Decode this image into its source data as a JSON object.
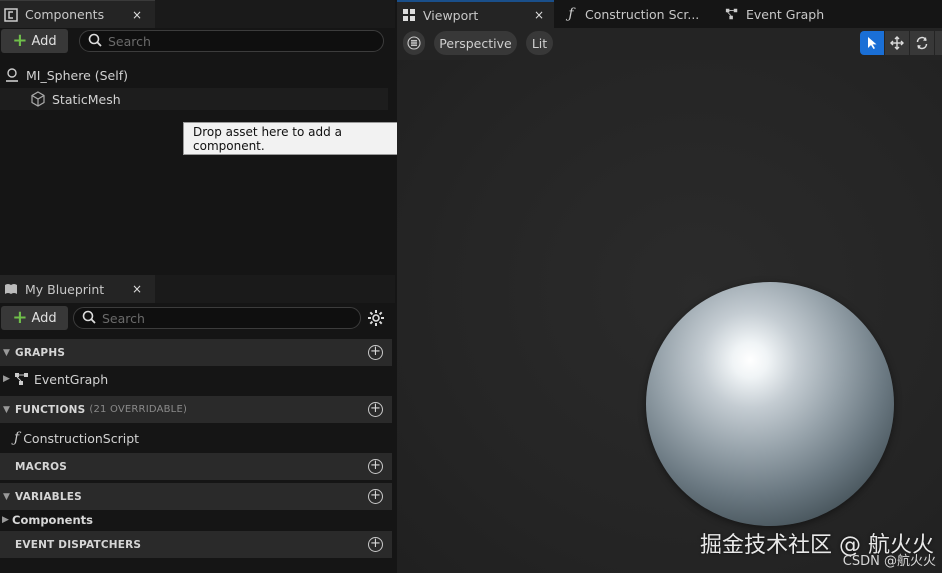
{
  "components_panel": {
    "tab_label": "Components",
    "close_glyph": "×",
    "add_label": "Add",
    "search_placeholder": "Search",
    "root_item": "MI_Sphere (Self)",
    "child_item": "StaticMesh",
    "tooltip": "Drop asset here to add a component."
  },
  "my_blueprint": {
    "tab_label": "My Blueprint",
    "close_glyph": "×",
    "add_label": "Add",
    "search_placeholder": "Search",
    "sections": {
      "graphs": "GRAPHS",
      "functions": "FUNCTIONS",
      "functions_note": "(21 OVERRIDABLE)",
      "macros": "MACROS",
      "variables": "VARIABLES",
      "components": "Components",
      "event_dispatchers": "EVENT DISPATCHERS"
    },
    "items": {
      "event_graph": "EventGraph",
      "construction_script": "ConstructionScript"
    }
  },
  "editor_tabs": {
    "viewport": "Viewport",
    "construction_script": "Construction Scr...",
    "event_graph": "Event Graph",
    "close_glyph": "×"
  },
  "viewport_toolbar": {
    "perspective": "Perspective",
    "lit": "Lit"
  },
  "watermark": {
    "line1": "掘金技术社区 @ 航火火",
    "line2": "CSDN @航火火"
  },
  "colors": {
    "accent_blue": "#1a6fd6",
    "add_plus_green": "#6fbf4a",
    "panel_bg": "#151515",
    "viewport_bg": "#242424"
  }
}
